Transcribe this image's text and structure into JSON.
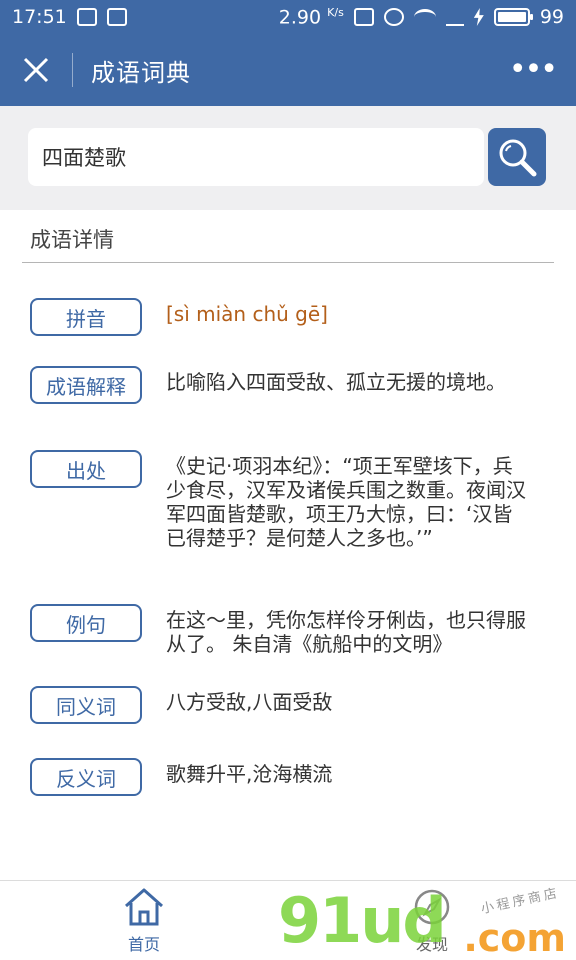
{
  "status_bar": {
    "time": "17:51",
    "speed": "2.90",
    "speed_unit": "K/s",
    "battery_level": 99,
    "battery_text": "99"
  },
  "nav": {
    "title": "成语词典",
    "more": "•••"
  },
  "search": {
    "value": "四面楚歌"
  },
  "section": {
    "title": "成语详情"
  },
  "details": [
    {
      "label": "拼音",
      "value": "[sì miàn chǔ gē]"
    },
    {
      "label": "成语解释",
      "value": "比喻陷入四面受敌、孤立无援的境地。"
    },
    {
      "label": "出处",
      "value": "《史记·项羽本纪》：“项王军壁垓下，兵少食尽，汉军及诸侯兵围之数重。夜闻汉军四面皆楚歌，项王乃大惊，曰：‘汉皆已得楚乎？是何楚人之多也。’”"
    },
    {
      "label": "例句",
      "value": "在这～里，凭你怎样伶牙俐齿，也只得服从了。 朱自清《航船中的文明》"
    },
    {
      "label": "同义词",
      "value": "八方受敌,八面受敌"
    },
    {
      "label": "反义词",
      "value": "歌舞升平,沧海横流"
    }
  ],
  "tabs": [
    {
      "label": "首页",
      "icon": "home-icon"
    },
    {
      "label": "发现",
      "icon": "compass-icon"
    }
  ],
  "watermark": {
    "main": "91ud",
    "com": ".com",
    "sub": "小程序商店"
  },
  "colors": {
    "brand": "#3f69a5",
    "pinyin": "#b35f1a"
  }
}
